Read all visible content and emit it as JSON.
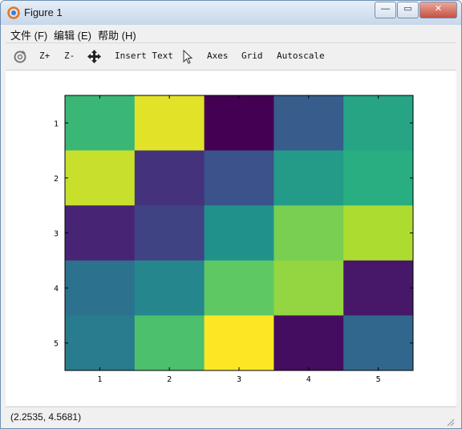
{
  "window": {
    "title": "Figure 1"
  },
  "title_buttons": {
    "minimize": "—",
    "maximize": "▭",
    "close": "✕"
  },
  "menu": [
    {
      "label": "文件 (F)"
    },
    {
      "label": "编辑 (E)"
    },
    {
      "label": "帮助 (H)"
    }
  ],
  "toolbar": {
    "zoom_in": "Z+",
    "zoom_out": "Z-",
    "insert_text": "Insert Text",
    "axes": "Axes",
    "grid": "Grid",
    "autoscale": "Autoscale"
  },
  "status": {
    "coords": "(2.2535, 4.5681)"
  },
  "chart_data": {
    "type": "heatmap",
    "x_ticks": [
      "1",
      "2",
      "3",
      "4",
      "5"
    ],
    "y_ticks": [
      "1",
      "2",
      "3",
      "4",
      "5"
    ],
    "xlim": [
      0.5,
      5.5
    ],
    "ylim": [
      0.5,
      5.5
    ],
    "y_direction": "reversed",
    "colormap": "viridis",
    "values": [
      [
        17,
        24,
        1,
        8,
        15
      ],
      [
        23,
        5,
        7,
        14,
        16
      ],
      [
        4,
        6,
        13,
        20,
        22
      ],
      [
        10,
        12,
        19,
        21,
        3
      ],
      [
        11,
        18,
        25,
        2,
        9
      ]
    ]
  }
}
